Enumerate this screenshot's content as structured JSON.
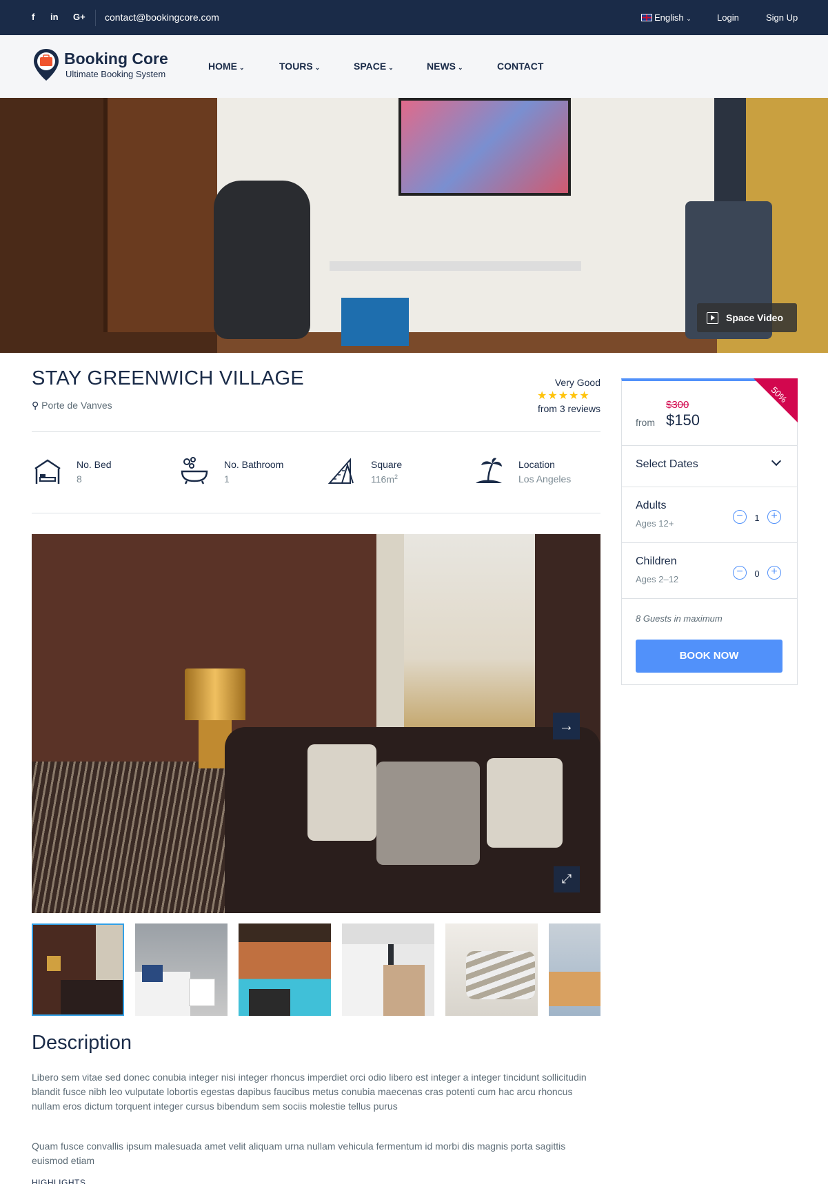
{
  "topbar": {
    "social": [
      "f",
      "in",
      "G+"
    ],
    "email": "contact@bookingcore.com",
    "language": "English",
    "login": "Login",
    "signup": "Sign Up"
  },
  "brand": {
    "name": "Booking Core",
    "tagline": "Ultimate Booking System"
  },
  "nav": {
    "items": [
      "HOME",
      "TOURS",
      "SPACE",
      "NEWS",
      "CONTACT"
    ]
  },
  "hero": {
    "video_label": "Space Video"
  },
  "space": {
    "title": "STAY GREENWICH VILLAGE",
    "location": "Porte de Vanves",
    "review_label": "Very Good",
    "stars": "★★★★★",
    "review_count": "from 3 reviews"
  },
  "features": [
    {
      "label": "No. Bed",
      "value": "8",
      "icon": "bed-icon"
    },
    {
      "label": "No. Bathroom",
      "value": "1",
      "icon": "bathtub-icon"
    },
    {
      "label": "Square",
      "value": "116m",
      "value_sup": "2",
      "icon": "ruler-icon"
    },
    {
      "label": "Location",
      "value": "Los Angeles",
      "icon": "palm-island-icon"
    }
  ],
  "description": {
    "heading": "Description",
    "p1": "Libero sem vitae sed donec conubia integer nisi integer rhoncus imperdiet orci odio libero est integer a integer tincidunt sollicitudin blandit fusce nibh leo vulputate lobortis egestas dapibus faucibus metus conubia maecenas cras potenti cum hac arcu rhoncus nullam eros dictum torquent integer cursus bibendum sem sociis molestie tellus purus",
    "p2": "Quam fusce convallis ipsum malesuada amet velit aliquam urna nullam vehicula fermentum id morbi dis magnis porta sagittis euismod etiam",
    "highlights": "HIGHLIGHTS"
  },
  "booking": {
    "discount": "50%",
    "old_price": "$300",
    "from": "from",
    "price": "$150",
    "select_dates": "Select Dates",
    "adults_label": "Adults",
    "adults_sub": "Ages 12+",
    "adults_value": "1",
    "children_label": "Children",
    "children_sub": "Ages 2–12",
    "children_value": "0",
    "max_guests": "8 Guests in maximum",
    "book_now": "BOOK NOW"
  },
  "colors": {
    "navy": "#1a2b48",
    "accent": "#5191fa",
    "discount": "#d2074e",
    "star": "#ffc30b"
  }
}
